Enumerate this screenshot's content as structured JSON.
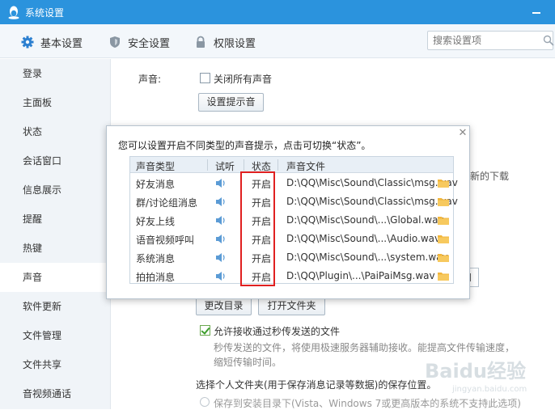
{
  "window": {
    "title": "系统设置"
  },
  "tabs": [
    {
      "label": "基本设置",
      "icon": "gear-icon",
      "active": true
    },
    {
      "label": "安全设置",
      "icon": "shield-icon"
    },
    {
      "label": "权限设置",
      "icon": "lock-icon"
    }
  ],
  "search": {
    "placeholder": "搜索设置项"
  },
  "sidebar": {
    "items": [
      {
        "label": "登录"
      },
      {
        "label": "主面板"
      },
      {
        "label": "状态"
      },
      {
        "label": "会话窗口"
      },
      {
        "label": "信息展示"
      },
      {
        "label": "提醒"
      },
      {
        "label": "热键"
      },
      {
        "label": "声音",
        "active": true
      },
      {
        "label": "软件更新"
      },
      {
        "label": "文件管理"
      },
      {
        "label": "文件共享"
      },
      {
        "label": "音视频通话"
      }
    ]
  },
  "main": {
    "sound_label": "声音:",
    "mute_all_label": "关闭所有声音",
    "notify_button": "设置提示音",
    "peek_download": "新的下载",
    "change_dir_button": "更改目录",
    "open_folder_button": "打开文件夹",
    "allow_receive_label": "允许接收通过秒传发送的文件",
    "allow_receive_desc": "秒传发送的文件，将使用极速服务器辅助接收。能提高文件传输速度，缩短传输时间。",
    "folder_title": "选择个人文件夹(用于保存消息记录等数据)的保存位置。",
    "radio_option": "保存到安装目录下(Vista、Windows 7或更高版本的系统不支持此选项)"
  },
  "dialog": {
    "tip": "您可以设置开启不同类型的声音提示，点击可切换“状态”。",
    "headers": {
      "type": "声音类型",
      "listen": "试听",
      "status": "状态",
      "file": "声音文件"
    },
    "rows": [
      {
        "type": "好友消息",
        "status": "开启",
        "file": "D:\\QQ\\Misc\\Sound\\Classic\\msg.wav"
      },
      {
        "type": "群/讨论组消息",
        "status": "开启",
        "file": "D:\\QQ\\Misc\\Sound\\Classic\\msg.wav"
      },
      {
        "type": "好友上线",
        "status": "开启",
        "file": "D:\\QQ\\Misc\\Sound\\...\\Global.wav"
      },
      {
        "type": "语音视频呼叫",
        "status": "开启",
        "file": "D:\\QQ\\Misc\\Sound\\...\\Audio.wav"
      },
      {
        "type": "系统消息",
        "status": "开启",
        "file": "D:\\QQ\\Misc\\Sound\\...\\system.wav"
      },
      {
        "type": "拍拍消息",
        "status": "开启",
        "file": "D:\\QQ\\Plugin\\...\\PaiPaiMsg.wav"
      }
    ]
  },
  "watermark": {
    "text": "Baidu经验",
    "sub": "jingyan.baidu.com"
  },
  "colors": {
    "titlebar": "#2b93dd",
    "highlight": "#e02020",
    "folder": "#f2b53a",
    "speaker": "#5b9bd5"
  }
}
